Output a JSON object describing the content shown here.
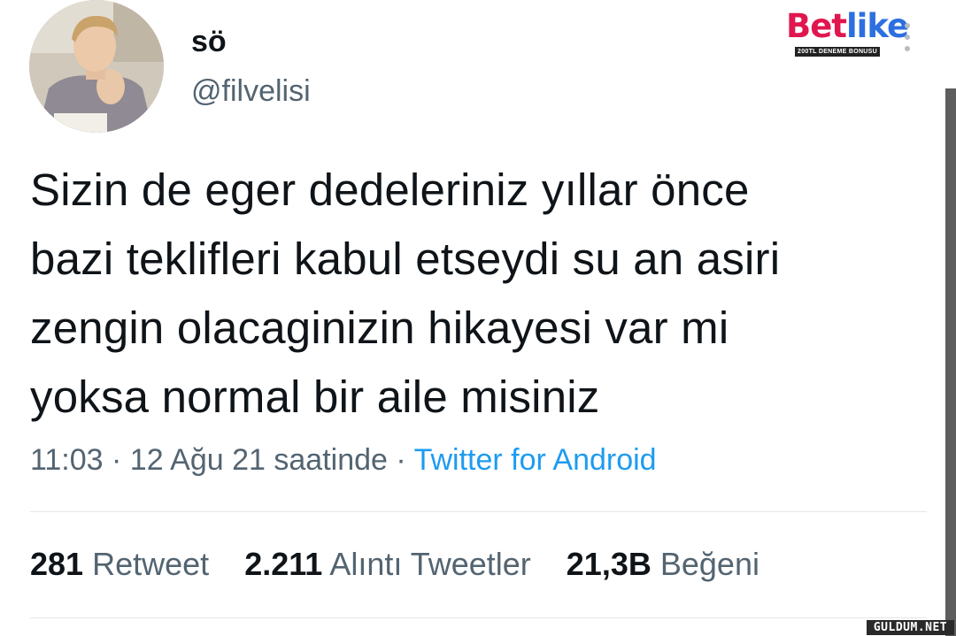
{
  "user": {
    "display_name": "sö",
    "handle": "@filvelisi",
    "avatar_icon": "profile-photo"
  },
  "ad": {
    "brand_part1": "Bet",
    "brand_part2": "like",
    "subtitle": "200TL DENEME BONUSU",
    "colors": {
      "bet": "#e0174f",
      "like": "#2c6fe0"
    }
  },
  "tweet": {
    "lines": [
      "Sizin de eger dedeleriniz yıllar önce",
      "bazi teklifleri kabul etseydi su an asiri",
      "zengin olacaginizin hikayesi var mi",
      "yoksa normal bir aile misiniz"
    ],
    "time": "11:03",
    "date": "12 Ağu 21 saatinde",
    "separator": "·",
    "source": "Twitter for Android"
  },
  "stats": {
    "retweets_count": "281",
    "retweets_label": "Retweet",
    "quotes_count": "2.211",
    "quotes_label": "Alıntı Tweetler",
    "likes_count": "21,3B",
    "likes_label": "Beğeni"
  },
  "watermark": "GULDUM.NET",
  "colors": {
    "text": "#0f1419",
    "muted": "#536471",
    "link": "#1d9bf0",
    "divider": "#e3e6e9"
  }
}
